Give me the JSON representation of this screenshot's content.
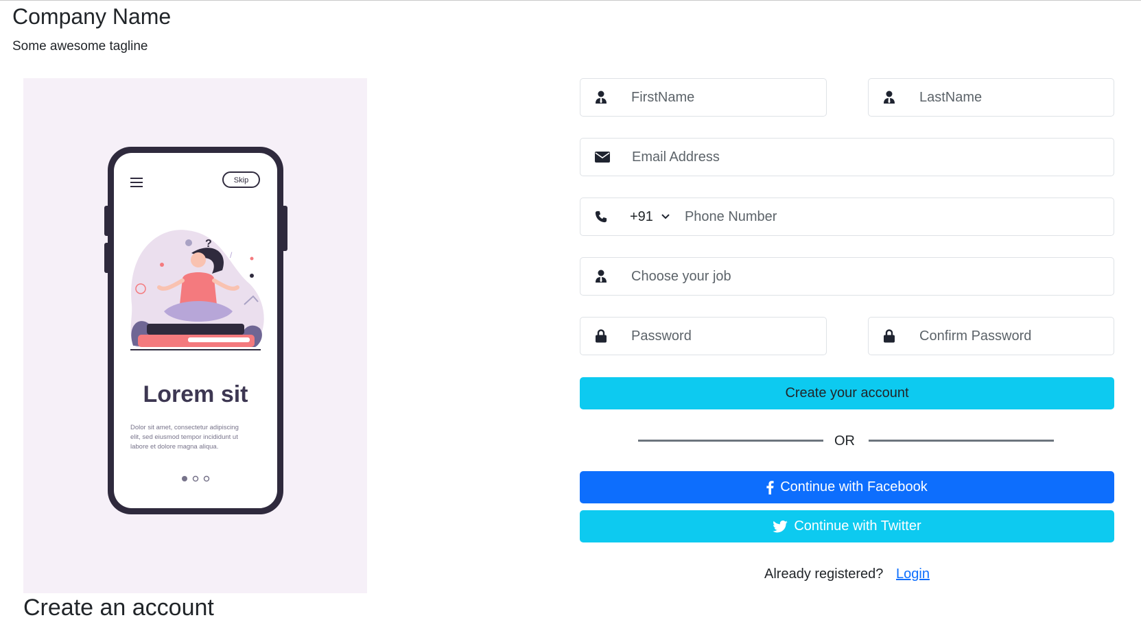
{
  "header": {
    "company_name": "Company Name",
    "tagline": "Some awesome tagline"
  },
  "illustration": {
    "skip_label": "Skip",
    "headline": "Lorem sit",
    "body_lines": [
      "Dolor sit amet, consectetur adipiscing",
      "elit, sed eiusmod tempor incididunt ut",
      "labore et dolore magna aliqua."
    ],
    "colors": {
      "panel_bg": "#f6f0f8",
      "phone_frame": "#2f2a3d",
      "accent_pink": "#f47a7e",
      "accent_purple": "#b7a6d8"
    }
  },
  "page_heading": "Create an account",
  "form": {
    "first_name": {
      "placeholder": "FirstName",
      "icon": "user-tie-icon"
    },
    "last_name": {
      "placeholder": "LastName",
      "icon": "user-tie-icon"
    },
    "email": {
      "placeholder": "Email Address",
      "icon": "envelope-icon"
    },
    "phone": {
      "country_code": "+91",
      "placeholder": "Phone Number",
      "icon": "phone-icon"
    },
    "job": {
      "placeholder": "Choose your job",
      "icon": "user-tie-icon"
    },
    "password": {
      "placeholder": "Password",
      "icon": "lock-icon"
    },
    "confirm_password": {
      "placeholder": "Confirm Password",
      "icon": "lock-icon"
    },
    "submit_label": "Create your account",
    "or_label": "OR",
    "facebook_label": "Continue with Facebook",
    "twitter_label": "Continue with Twitter",
    "already_registered": "Already registered?",
    "login_label": "Login"
  },
  "colors": {
    "primary": "#0d6efd",
    "info": "#0dcaf0",
    "border": "#dee2e6",
    "divider": "#6c757d"
  }
}
